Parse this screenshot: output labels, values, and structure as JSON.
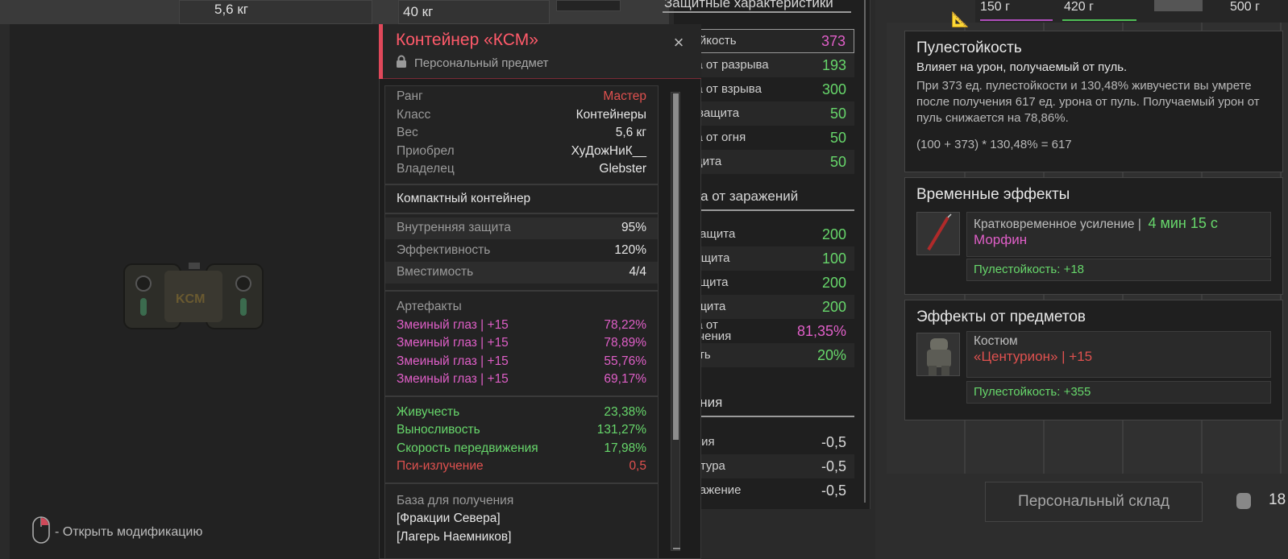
{
  "top_weights": [
    "5,6 кг",
    "40 кг"
  ],
  "top_right_weights": [
    "150 г",
    "420 г",
    "500 г"
  ],
  "hint": {
    "text": "- Открыть модификацию"
  },
  "card": {
    "title": "Контейнер «КСМ»",
    "subtitle": "Персональный предмет",
    "info": [
      {
        "label": "Ранг",
        "value": "Мастер",
        "color": "#e0514f"
      },
      {
        "label": "Класс",
        "value": "Контейнеры"
      },
      {
        "label": "Вес",
        "value": "5,6 кг"
      },
      {
        "label": "Приобрел",
        "value": "ХуДожНиК__"
      },
      {
        "label": "Владелец",
        "value": "Glebster"
      }
    ],
    "description": "Компактный контейнер",
    "stats": [
      {
        "label": "Внутренняя защита",
        "value": "95%"
      },
      {
        "label": "Эффективность",
        "value": "120%"
      },
      {
        "label": "Вместимость",
        "value": "4/4"
      }
    ],
    "artifacts_title": "Артефакты",
    "artifacts": [
      {
        "label": "Змеиный глаз | +15",
        "value": "78,22%"
      },
      {
        "label": "Змеиный глаз | +15",
        "value": "78,89%"
      },
      {
        "label": "Змеиный глаз | +15",
        "value": "55,76%"
      },
      {
        "label": "Змеиный глаз | +15",
        "value": "69,17%"
      }
    ],
    "effects": [
      {
        "label": "Живучесть",
        "value": "23,38%",
        "color": "green"
      },
      {
        "label": "Выносливость",
        "value": "131,27%",
        "color": "green"
      },
      {
        "label": "Скорость передвижения",
        "value": "17,98%",
        "color": "green"
      },
      {
        "label": "Пси-излучение",
        "value": "0,5",
        "color": "red"
      }
    ],
    "base_title": "База для получения",
    "bases": [
      "[Фракции Севера]",
      "[Лагерь Наемников]"
    ]
  },
  "protection": {
    "title": "Защитные характеристики",
    "rows": [
      {
        "label": "естойкость",
        "value": "373",
        "color": "pink",
        "highlight": true
      },
      {
        "label": "щита от разрыва",
        "value": "193",
        "color": "green"
      },
      {
        "label": "щита от взрыва",
        "value": "300",
        "color": "green"
      },
      {
        "label": "ктрозащита",
        "value": "50",
        "color": "green"
      },
      {
        "label": "щита от огня",
        "value": "50",
        "color": "green"
      },
      {
        "label": "озащита",
        "value": "50",
        "color": "green"
      }
    ],
    "infection_title": "щита от заражений",
    "infection_rows": [
      {
        "label": "диозащита",
        "value": "200",
        "color": "green"
      },
      {
        "label": "мозащита",
        "value": "100",
        "color": "green"
      },
      {
        "label": "розащита",
        "value": "200",
        "color": "green"
      },
      {
        "label": "и-защита",
        "value": "200",
        "color": "green"
      },
      {
        "label": "щита от\nвотечения",
        "value": "81,35%",
        "color": "pink"
      },
      {
        "label": "йкость",
        "value": "20%",
        "color": "green"
      }
    ],
    "damage_title": "ажения",
    "damage_rows": [
      {
        "label": "диация",
        "value": "-0,5"
      },
      {
        "label": "пература",
        "value": "-0,5"
      },
      {
        "label": "озаражение",
        "value": "-0,5"
      }
    ]
  },
  "tooltip": {
    "title": "Пулестойкость",
    "lead": "Влияет на урон, получаемый от пуль.",
    "body": "При 373 ед. пулестойкости и 130,48% живучести вы умрете после получения 617 ед. урона от пуль. Получаемый урон от пуль снижается на 78,86%.",
    "formula": "(100 + 373) * 130,48% = 617"
  },
  "temp_effects": {
    "title": "Временные эффекты",
    "type": "Кратковременное усиление |",
    "duration": "4 мин 15 с",
    "name": "Морфин",
    "bonus": "Пулестойкость: +18"
  },
  "item_effects": {
    "title": "Эффекты от предметов",
    "type": "Костюм",
    "name": "«Центурион» | +15",
    "bonus": "Пулестойкость: +355"
  },
  "storage": {
    "label": "Персональный склад",
    "count": "18"
  }
}
